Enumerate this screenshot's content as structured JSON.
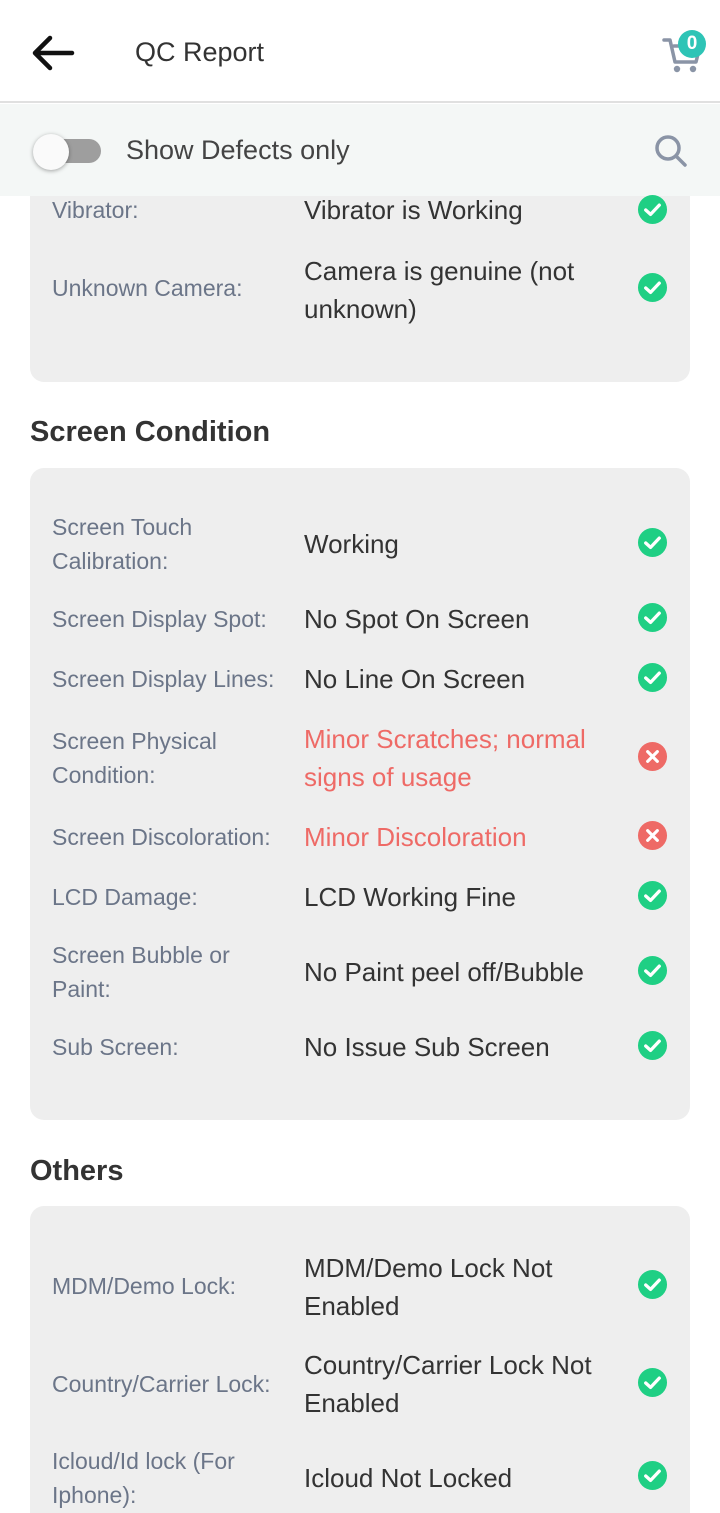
{
  "header": {
    "title": "QC Report",
    "cart_count": "0"
  },
  "filter": {
    "label": "Show Defects only",
    "toggle_on": false
  },
  "colors": {
    "pass": "#1fcf84",
    "fail": "#ee6a66",
    "badge": "#2ec4b6"
  },
  "top_rows": [
    {
      "label": "Vibrator:",
      "value": "Vibrator is Working",
      "status": "pass"
    },
    {
      "label": "Unknown Camera:",
      "value": "Camera is genuine (not unknown)",
      "status": "pass"
    }
  ],
  "screen_condition": {
    "title": "Screen Condition",
    "rows": [
      {
        "label": "Screen Touch Calibration:",
        "value": "Working",
        "status": "pass"
      },
      {
        "label": "Screen Display Spot:",
        "value": "No Spot On Screen",
        "status": "pass"
      },
      {
        "label": "Screen Display Lines:",
        "value": "No Line On Screen",
        "status": "pass"
      },
      {
        "label": "Screen Physical Condition:",
        "value": "Minor Scratches; normal signs of usage",
        "status": "fail"
      },
      {
        "label": "Screen Discoloration:",
        "value": "Minor Discoloration",
        "status": "fail"
      },
      {
        "label": "LCD Damage:",
        "value": "LCD Working Fine",
        "status": "pass"
      },
      {
        "label": "Screen Bubble or Paint:",
        "value": "No Paint peel off/Bubble",
        "status": "pass"
      },
      {
        "label": "Sub Screen:",
        "value": "No Issue Sub Screen",
        "status": "pass"
      }
    ]
  },
  "others": {
    "title": "Others",
    "rows": [
      {
        "label": "MDM/Demo Lock:",
        "value": "MDM/Demo Lock Not Enabled",
        "status": "pass"
      },
      {
        "label": "Country/Carrier Lock:",
        "value": "Country/Carrier Lock Not Enabled",
        "status": "pass"
      },
      {
        "label": "Icloud/Id lock (For Iphone):",
        "value": "Icloud Not Locked",
        "status": "pass"
      }
    ]
  }
}
